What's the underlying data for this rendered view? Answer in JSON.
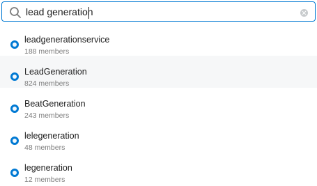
{
  "search": {
    "value": "lead generation",
    "icons": {
      "search": "search-icon",
      "clear": "clear-icon"
    }
  },
  "results": [
    {
      "name": "leadgenerationservice",
      "members": "188 members",
      "highlighted": false
    },
    {
      "name": "LeadGeneration",
      "members": "824 members",
      "highlighted": true
    },
    {
      "name": "BeatGeneration",
      "members": "243 members",
      "highlighted": false
    },
    {
      "name": "lelegeneration",
      "members": "48 members",
      "highlighted": false
    },
    {
      "name": "legeneration",
      "members": "12 members",
      "highlighted": false
    }
  ],
  "colors": {
    "accent": "#0079d3",
    "hover": "#f6f7f8",
    "muted": "#7c7c7c"
  }
}
